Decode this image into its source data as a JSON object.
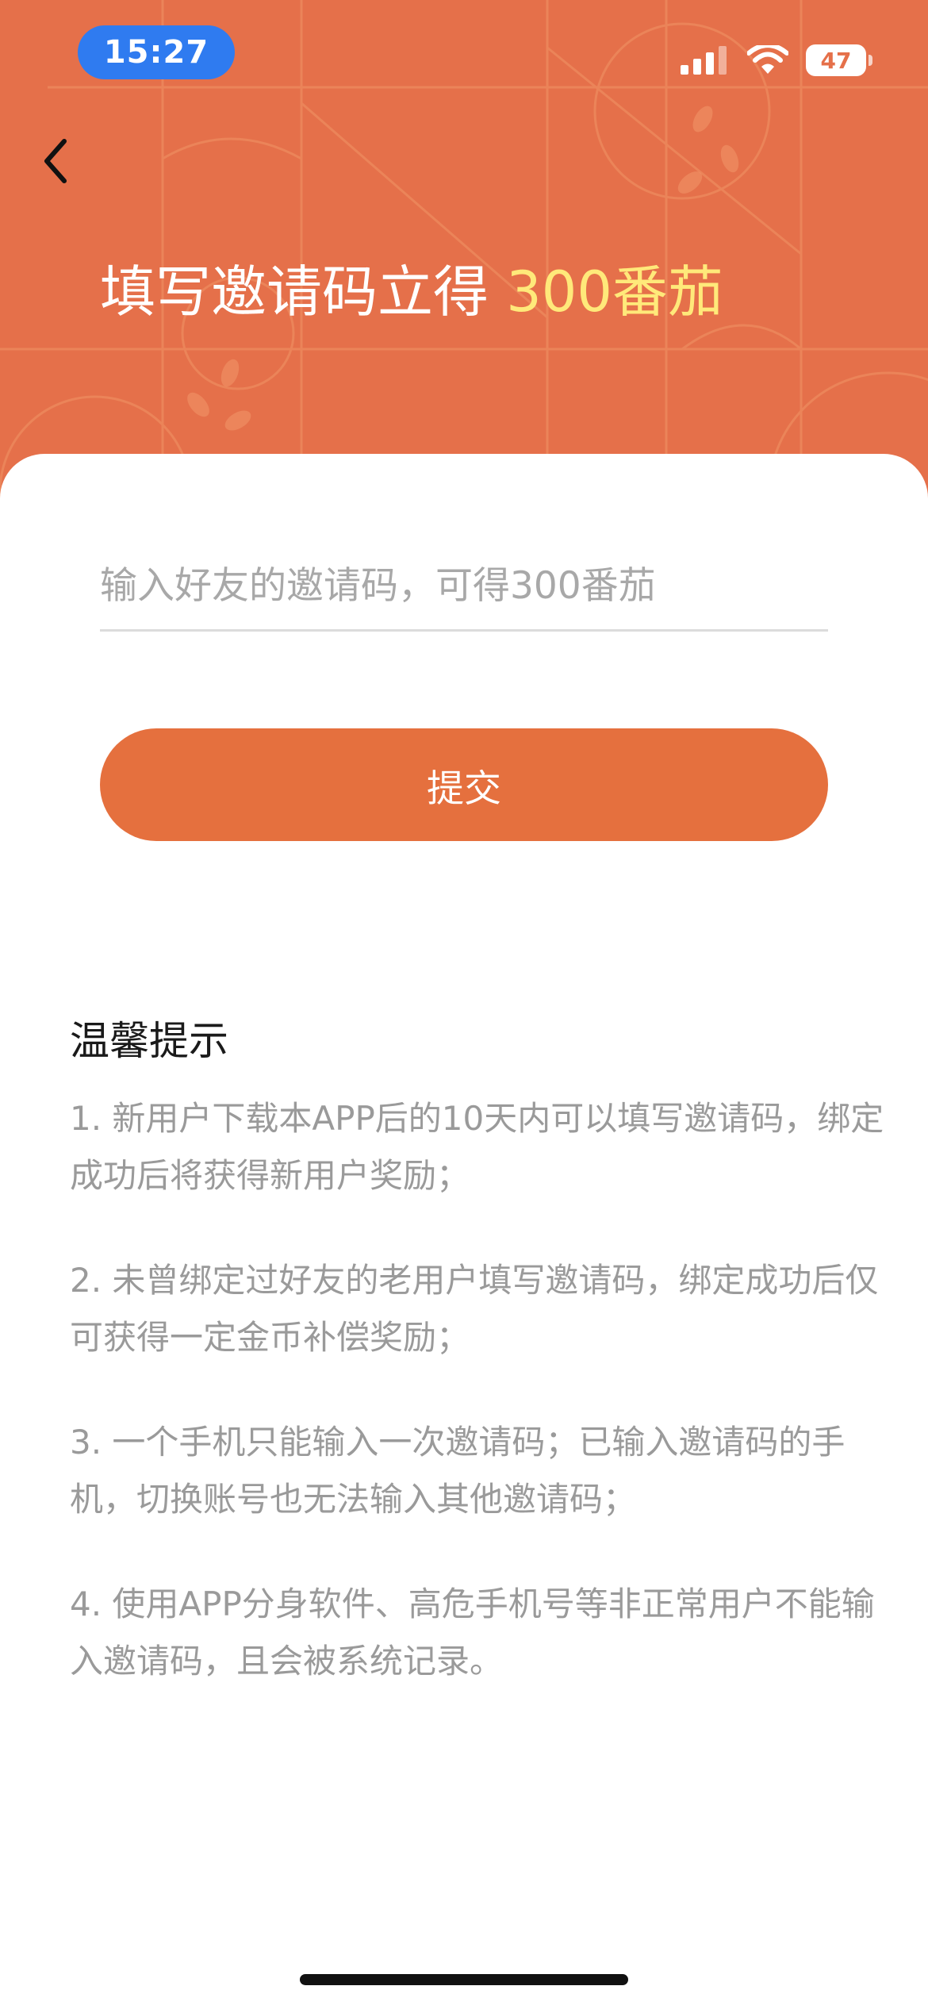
{
  "status_bar": {
    "time": "15:27",
    "battery": "47"
  },
  "header": {
    "title_prefix": "填写邀请码立得 ",
    "title_amount": "300番茄"
  },
  "form": {
    "input_placeholder": "输入好友的邀请码，可得300番茄",
    "submit_label": "提交"
  },
  "tips": {
    "title": "温馨提示",
    "items": [
      "1. 新用户下载本APP后的10天内可以填写邀请码，绑定成功后将获得新用户奖励；",
      "2. 未曾绑定过好友的老用户填写邀请码，绑定成功后仅可获得一定金币补偿奖励；",
      "3. 一个手机只能输入一次邀请码；已输入邀请码的手机，切换账号也无法输入其他邀请码；",
      "4. 使用APP分身软件、高危手机号等非正常用户不能输入邀请码，且会被系统记录。"
    ]
  },
  "colors": {
    "header_bg": "#e5704a",
    "accent_amount": "#ffe97a",
    "button_bg": "#e5703e",
    "time_pill": "#2f7bf0"
  },
  "icons": {
    "back": "chevron-left-icon",
    "signal": "cellular-signal-icon",
    "wifi": "wifi-icon",
    "battery": "battery-icon"
  }
}
